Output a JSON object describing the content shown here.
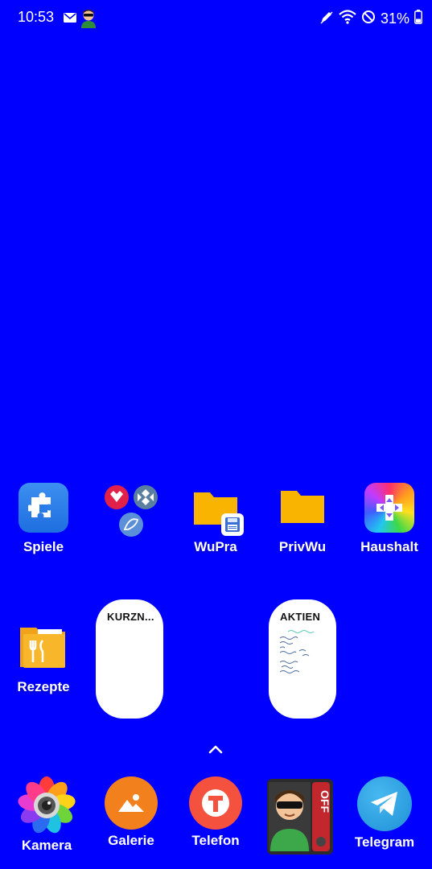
{
  "status_bar": {
    "time": "10:53",
    "battery": "31%",
    "left_icons": [
      "mail-icon",
      "avatar-notification-icon"
    ],
    "right_icons": [
      "pen-icon",
      "wifi-icon",
      "do-not-disturb-icon",
      "battery-icon"
    ]
  },
  "home": {
    "row1": [
      {
        "label": "Spiele",
        "icon": "puzzle-icon"
      },
      {
        "label": "",
        "icon": "app-cluster-icon"
      },
      {
        "label": "WuPra",
        "icon": "folder-icon"
      },
      {
        "label": "PrivWu",
        "icon": "folder-icon"
      },
      {
        "label": "Haushalt",
        "icon": "gamepad-icon"
      }
    ],
    "rezepte": {
      "label": "Rezepte",
      "icon": "recipe-folder-icon"
    },
    "widgets": [
      {
        "title": "KURZN..."
      },
      {
        "title": "AKTIEN"
      }
    ]
  },
  "dock": [
    {
      "label": "Kamera",
      "icon": "camera-icon"
    },
    {
      "label": "Galerie",
      "icon": "gallery-icon"
    },
    {
      "label": "Telefon",
      "icon": "phone-t-icon"
    },
    {
      "label": "",
      "icon": "off-switch-avatar-icon"
    },
    {
      "label": "Telegram",
      "icon": "telegram-icon"
    }
  ],
  "colors": {
    "wallpaper": "#0000FF",
    "folder_yellow": "#F8B400",
    "spiele_blue": "#2A7BE8",
    "gallery_orange": "#F2811D",
    "telefon_red": "#F4513F",
    "telegram_blue": "#2AA3E0"
  }
}
